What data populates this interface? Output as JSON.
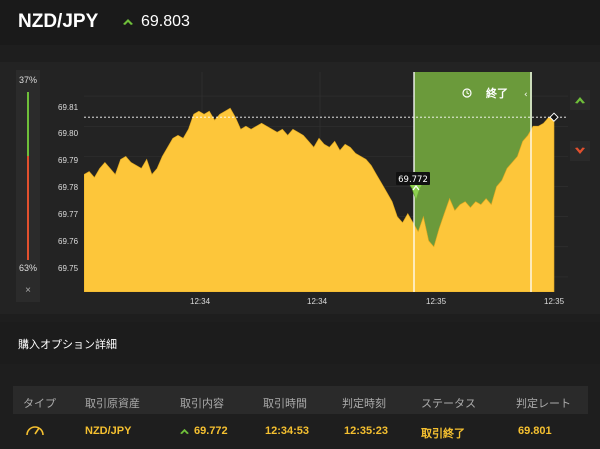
{
  "header": {
    "pair": "NZD/JPY",
    "price": "69.803"
  },
  "sidebar": {
    "up_pct": "37%",
    "down_pct": "63%",
    "close": "×"
  },
  "chart_data": {
    "type": "area",
    "y_ticks": [
      "69.81",
      "69.80",
      "69.79",
      "69.78",
      "69.77",
      "69.76",
      "69.75"
    ],
    "x_ticks": [
      "12:34",
      "12:34",
      "12:35",
      "12:35"
    ],
    "ylim": [
      69.745,
      69.818
    ],
    "current_rate": 69.803,
    "entry_rate": "69.772",
    "expiry_label": "終了",
    "area_color": "#fdc63a",
    "window_color": "#6b9a3b",
    "y": [
      69.784,
      69.785,
      69.783,
      69.786,
      69.788,
      69.786,
      69.784,
      69.789,
      69.79,
      69.788,
      69.787,
      69.786,
      69.789,
      69.784,
      69.786,
      69.79,
      69.793,
      69.796,
      69.797,
      69.796,
      69.799,
      69.804,
      69.805,
      69.804,
      69.805,
      69.802,
      69.804,
      69.805,
      69.806,
      69.803,
      69.799,
      69.8,
      69.799,
      69.8,
      69.801,
      69.8,
      69.799,
      69.798,
      69.799,
      69.797,
      69.799,
      69.798,
      69.797,
      69.795,
      69.793,
      69.796,
      69.794,
      69.793,
      69.795,
      69.792,
      69.794,
      69.793,
      69.791,
      69.79,
      69.789,
      69.787,
      69.784,
      69.781,
      69.778,
      69.775,
      69.77,
      69.768,
      69.771,
      69.768,
      69.765,
      69.77,
      69.762,
      69.76,
      69.766,
      69.771,
      69.776,
      69.772,
      69.774,
      69.775,
      69.773,
      69.775,
      69.774,
      69.776,
      69.774,
      69.78,
      69.782,
      69.786,
      69.788,
      69.79,
      69.795,
      69.797,
      69.8,
      69.8,
      69.801,
      69.803,
      69.802
    ]
  },
  "option_details": {
    "title": "購入オプション詳細",
    "headers": [
      "タイプ",
      "取引原資産",
      "取引内容",
      "取引時間",
      "判定時刻",
      "ステータス",
      "判定レート"
    ],
    "row": {
      "asset": "NZD/JPY",
      "content": "69.772",
      "trade_time": "12:34:53",
      "judge_time": "12:35:23",
      "status": "取引終了",
      "rate": "69.801"
    }
  },
  "colors": {
    "up": "#6fbf3a",
    "down": "#e2502e",
    "accent": "#f5c030"
  }
}
